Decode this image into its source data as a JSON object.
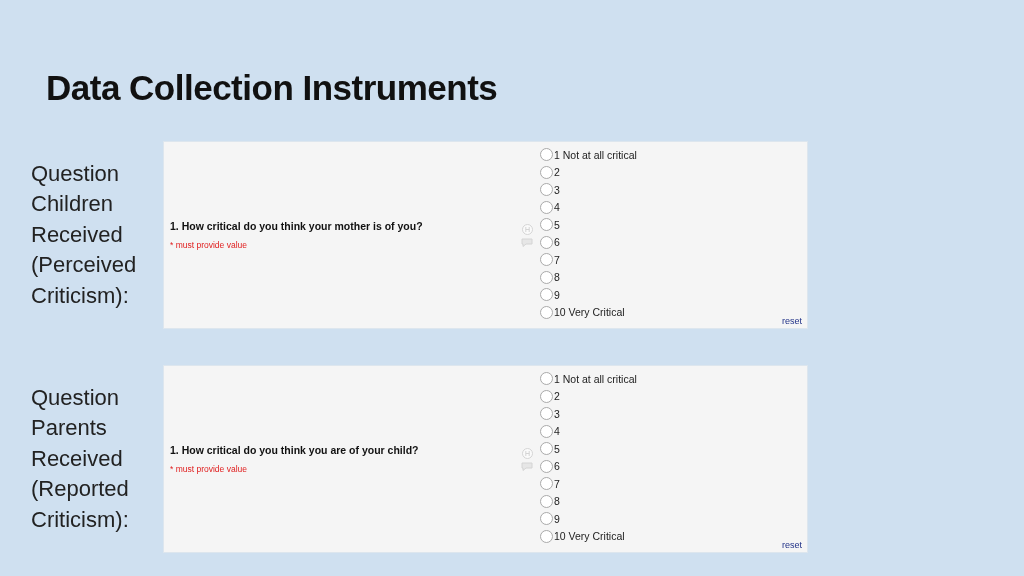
{
  "title": "Data Collection Instruments",
  "sections": [
    {
      "label": "Question Children Received (Perceived Criticism):",
      "question": "1. How critical do you think your mother is of you?",
      "required": "* must provide value",
      "options": [
        {
          "label": "1 Not at all critical",
          "selected": false
        },
        {
          "label": "2",
          "selected": false
        },
        {
          "label": "3",
          "selected": false
        },
        {
          "label": "4",
          "selected": false
        },
        {
          "label": "5",
          "selected": false
        },
        {
          "label": "6",
          "selected": false
        },
        {
          "label": "7",
          "selected": false
        },
        {
          "label": "8",
          "selected": false
        },
        {
          "label": "9",
          "selected": false
        },
        {
          "label": "10 Very Critical",
          "selected": false
        }
      ],
      "reset": "reset"
    },
    {
      "label": "Question Parents Received (Reported Criticism):",
      "question": "1. How critical do you think you are of your child?",
      "required": "* must provide value",
      "options": [
        {
          "label": "1 Not at all critical",
          "selected": false
        },
        {
          "label": "2",
          "selected": false
        },
        {
          "label": "3",
          "selected": false
        },
        {
          "label": "4",
          "selected": false
        },
        {
          "label": "5",
          "selected": false
        },
        {
          "label": "6",
          "selected": false
        },
        {
          "label": "7",
          "selected": false
        },
        {
          "label": "8",
          "selected": false
        },
        {
          "label": "9",
          "selected": false
        },
        {
          "label": "10 Very Critical",
          "selected": false
        }
      ],
      "reset": "reset"
    }
  ]
}
